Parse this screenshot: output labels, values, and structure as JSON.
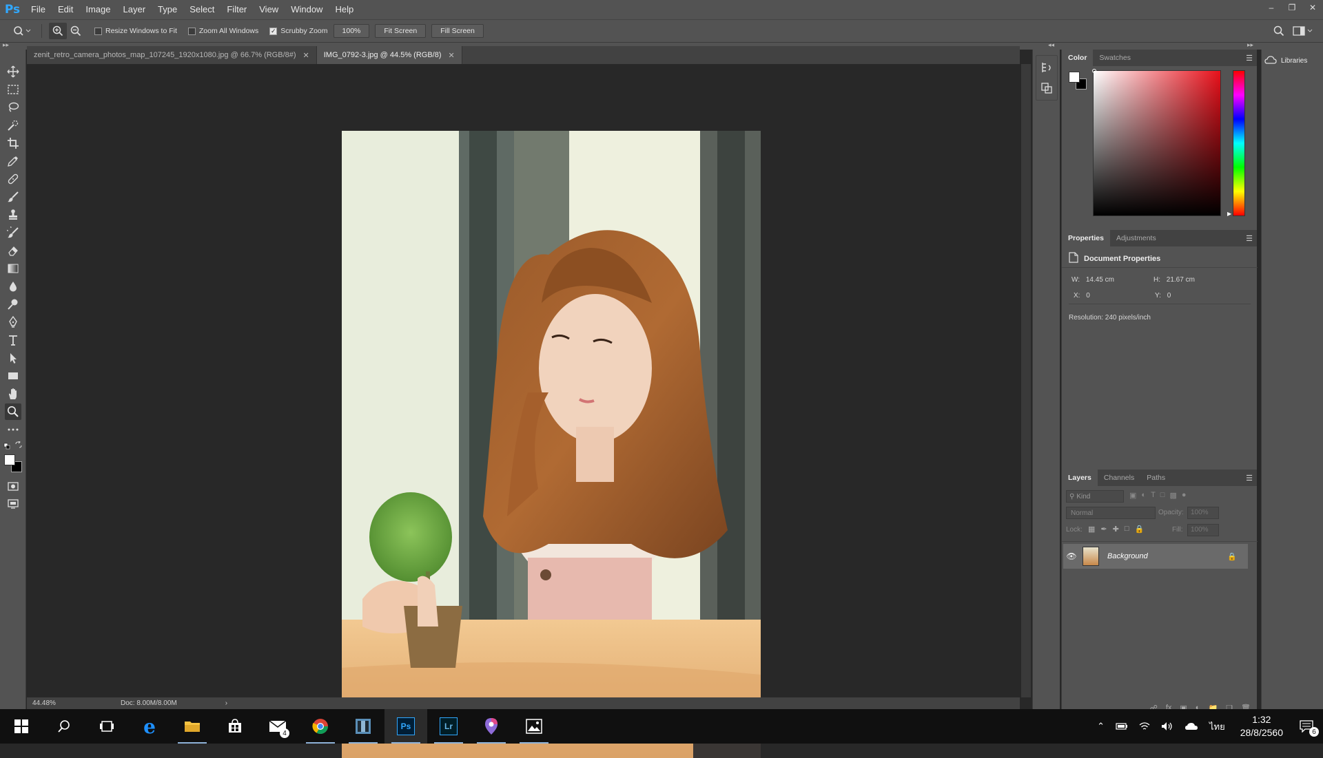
{
  "app": {
    "logo": "Ps",
    "menu": [
      "File",
      "Edit",
      "Image",
      "Layer",
      "Type",
      "Select",
      "Filter",
      "View",
      "Window",
      "Help"
    ]
  },
  "options_bar": {
    "resize_windows": "Resize Windows to Fit",
    "zoom_all": "Zoom All Windows",
    "scrubby_zoom": "Scrubby Zoom",
    "btn_100": "100%",
    "btn_fit": "Fit Screen",
    "btn_fill": "Fill Screen"
  },
  "tabs": [
    {
      "label": "zenit_retro_camera_photos_map_107245_1920x1080.jpg @ 66.7% (RGB/8#)"
    },
    {
      "label": "IMG_0792-3.jpg @ 44.5% (RGB/8)"
    }
  ],
  "status": {
    "zoom": "44.48%",
    "doc": "Doc: 8.00M/8.00M"
  },
  "color_panel": {
    "tab_color": "Color",
    "tab_swatches": "Swatches"
  },
  "properties_panel": {
    "tab_properties": "Properties",
    "tab_adjustments": "Adjustments",
    "title": "Document Properties",
    "w_label": "W:",
    "w_value": "14.45 cm",
    "h_label": "H:",
    "h_value": "21.67 cm",
    "x_label": "X:",
    "x_value": "0",
    "y_label": "Y:",
    "y_value": "0",
    "resolution": "Resolution: 240 pixels/inch"
  },
  "layers_panel": {
    "tab_layers": "Layers",
    "tab_channels": "Channels",
    "tab_paths": "Paths",
    "kind": "Kind",
    "blend_mode": "Normal",
    "opacity_label": "Opacity:",
    "opacity_value": "100%",
    "lock_label": "Lock:",
    "fill_label": "Fill:",
    "fill_value": "100%",
    "layer_name": "Background"
  },
  "libraries": {
    "label": "Libraries"
  },
  "taskbar": {
    "mail_badge": "4",
    "lang": "ไทย",
    "time": "1:32",
    "date": "28/8/2560",
    "notif_badge": "6"
  },
  "colors": {
    "ps_blue": "#31a8ff",
    "ui_gray": "#535353",
    "canvas_bg": "#282828"
  }
}
